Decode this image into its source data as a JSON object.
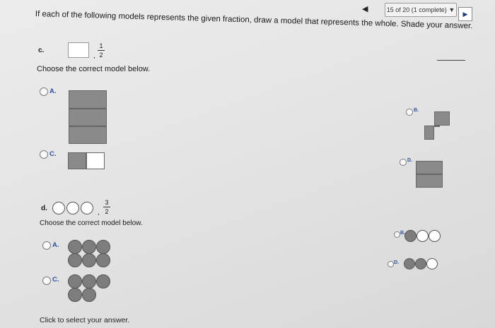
{
  "nav": {
    "prev": "◀",
    "progress": "15 of 20 (1 complete)",
    "progress_caret": "▼",
    "next": "▶"
  },
  "instruction": "If each of the following models represents the given fraction, draw a model that represents the whole. Shade your answer.",
  "parts": {
    "c": {
      "label": "c.",
      "comma": ",",
      "frac_num": "1",
      "frac_den": "2",
      "prompt": "Choose the correct model below.",
      "options": {
        "A": "A.",
        "B": "B.",
        "C": "C.",
        "D": "D."
      }
    },
    "d": {
      "label": "d.",
      "comma": ",",
      "frac_num": "3",
      "frac_den": "2",
      "prompt": "Choose the correct model below.",
      "options": {
        "A": "A.",
        "B": "B.",
        "C": "C.",
        "D": "D."
      }
    }
  },
  "footer": "Click to select your answer.",
  "colors": {
    "shade": "#7d7d7d",
    "link_blue": "#2a4ea0"
  }
}
